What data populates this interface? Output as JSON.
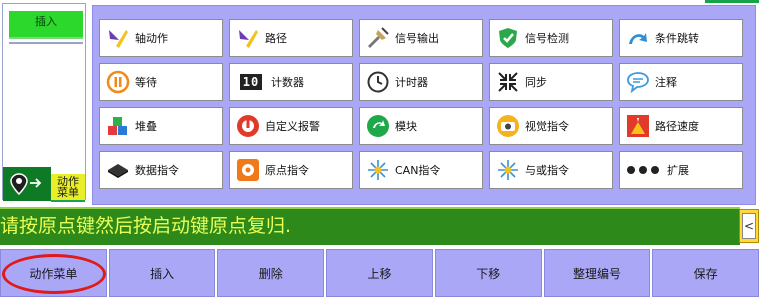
{
  "left": {
    "insert_tab": "插入",
    "motion_menu_line1": "动作",
    "motion_menu_line2": "菜单"
  },
  "grid": [
    [
      {
        "label": "轴动作",
        "icon": "axis-motion-icon"
      },
      {
        "label": "路径",
        "icon": "path-icon"
      },
      {
        "label": "信号输出",
        "icon": "signal-output-icon"
      },
      {
        "label": "信号检测",
        "icon": "signal-detect-icon"
      },
      {
        "label": "条件跳转",
        "icon": "conditional-jump-icon"
      }
    ],
    [
      {
        "label": "等待",
        "icon": "pause-icon"
      },
      {
        "label": "计数器",
        "icon": "counter-icon"
      },
      {
        "label": "计时器",
        "icon": "timer-icon"
      },
      {
        "label": "同步",
        "icon": "sync-icon"
      },
      {
        "label": "注释",
        "icon": "comment-icon"
      }
    ],
    [
      {
        "label": "堆叠",
        "icon": "stack-icon"
      },
      {
        "label": "自定义报警",
        "icon": "alarm-icon"
      },
      {
        "label": "模块",
        "icon": "module-icon"
      },
      {
        "label": "视觉指令",
        "icon": "camera-icon"
      },
      {
        "label": "路径速度",
        "icon": "path-speed-icon"
      }
    ],
    [
      {
        "label": "数据指令",
        "icon": "data-icon"
      },
      {
        "label": "原点指令",
        "icon": "origin-icon"
      },
      {
        "label": "CAN指令",
        "icon": "can-icon"
      },
      {
        "label": "与或指令",
        "icon": "and-or-icon"
      },
      {
        "label": "扩展",
        "icon": "extend-icon"
      }
    ]
  ],
  "message": "请按原点键然后按启动键原点复归.",
  "message_arrow": "<",
  "counter_text": "10",
  "toolbar": [
    "动作菜单",
    "插入",
    "删除",
    "上移",
    "下移",
    "整理编号",
    "保存"
  ],
  "colors": {
    "panel": "#a9a7f6",
    "message_bg": "#2d8a1a",
    "message_text": "#eaff55",
    "insert_tab": "#2dd82d",
    "motion_tab": "#e8ef2a",
    "highlight_ellipse": "#e01a1a"
  }
}
